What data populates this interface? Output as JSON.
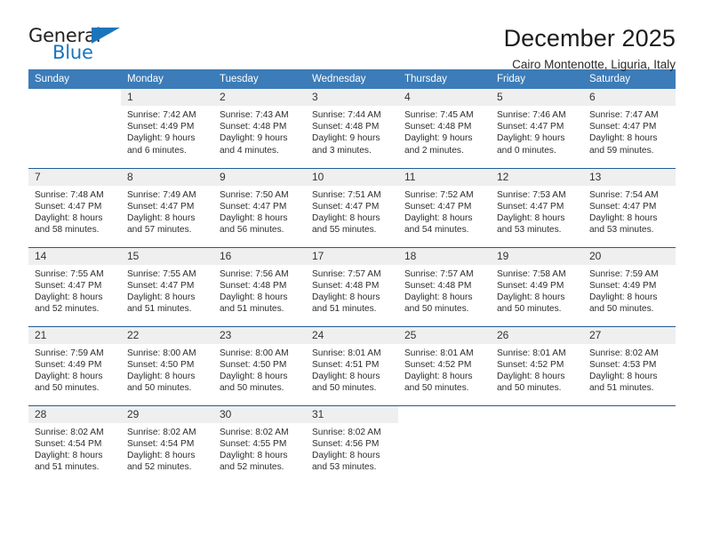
{
  "logo": {
    "word_one": "General",
    "word_two": "Blue",
    "triangle_icon": "triangle-icon",
    "brand_color": "#1b75bb"
  },
  "header": {
    "title": "December 2025",
    "subtitle": "Cairo Montenotte, Liguria, Italy"
  },
  "colors": {
    "header_bar": "#3c7cb8",
    "row_divider": "#1f5c99",
    "daynum_band": "#efefef"
  },
  "weekday_headers": [
    "Sunday",
    "Monday",
    "Tuesday",
    "Wednesday",
    "Thursday",
    "Friday",
    "Saturday"
  ],
  "weeks": [
    [
      {
        "day": "",
        "blank": true
      },
      {
        "day": "1",
        "sunrise": "Sunrise: 7:42 AM",
        "sunset": "Sunset: 4:49 PM",
        "daylight1": "Daylight: 9 hours",
        "daylight2": "and 6 minutes."
      },
      {
        "day": "2",
        "sunrise": "Sunrise: 7:43 AM",
        "sunset": "Sunset: 4:48 PM",
        "daylight1": "Daylight: 9 hours",
        "daylight2": "and 4 minutes."
      },
      {
        "day": "3",
        "sunrise": "Sunrise: 7:44 AM",
        "sunset": "Sunset: 4:48 PM",
        "daylight1": "Daylight: 9 hours",
        "daylight2": "and 3 minutes."
      },
      {
        "day": "4",
        "sunrise": "Sunrise: 7:45 AM",
        "sunset": "Sunset: 4:48 PM",
        "daylight1": "Daylight: 9 hours",
        "daylight2": "and 2 minutes."
      },
      {
        "day": "5",
        "sunrise": "Sunrise: 7:46 AM",
        "sunset": "Sunset: 4:47 PM",
        "daylight1": "Daylight: 9 hours",
        "daylight2": "and 0 minutes."
      },
      {
        "day": "6",
        "sunrise": "Sunrise: 7:47 AM",
        "sunset": "Sunset: 4:47 PM",
        "daylight1": "Daylight: 8 hours",
        "daylight2": "and 59 minutes."
      }
    ],
    [
      {
        "day": "7",
        "sunrise": "Sunrise: 7:48 AM",
        "sunset": "Sunset: 4:47 PM",
        "daylight1": "Daylight: 8 hours",
        "daylight2": "and 58 minutes."
      },
      {
        "day": "8",
        "sunrise": "Sunrise: 7:49 AM",
        "sunset": "Sunset: 4:47 PM",
        "daylight1": "Daylight: 8 hours",
        "daylight2": "and 57 minutes."
      },
      {
        "day": "9",
        "sunrise": "Sunrise: 7:50 AM",
        "sunset": "Sunset: 4:47 PM",
        "daylight1": "Daylight: 8 hours",
        "daylight2": "and 56 minutes."
      },
      {
        "day": "10",
        "sunrise": "Sunrise: 7:51 AM",
        "sunset": "Sunset: 4:47 PM",
        "daylight1": "Daylight: 8 hours",
        "daylight2": "and 55 minutes."
      },
      {
        "day": "11",
        "sunrise": "Sunrise: 7:52 AM",
        "sunset": "Sunset: 4:47 PM",
        "daylight1": "Daylight: 8 hours",
        "daylight2": "and 54 minutes."
      },
      {
        "day": "12",
        "sunrise": "Sunrise: 7:53 AM",
        "sunset": "Sunset: 4:47 PM",
        "daylight1": "Daylight: 8 hours",
        "daylight2": "and 53 minutes."
      },
      {
        "day": "13",
        "sunrise": "Sunrise: 7:54 AM",
        "sunset": "Sunset: 4:47 PM",
        "daylight1": "Daylight: 8 hours",
        "daylight2": "and 53 minutes."
      }
    ],
    [
      {
        "day": "14",
        "sunrise": "Sunrise: 7:55 AM",
        "sunset": "Sunset: 4:47 PM",
        "daylight1": "Daylight: 8 hours",
        "daylight2": "and 52 minutes."
      },
      {
        "day": "15",
        "sunrise": "Sunrise: 7:55 AM",
        "sunset": "Sunset: 4:47 PM",
        "daylight1": "Daylight: 8 hours",
        "daylight2": "and 51 minutes."
      },
      {
        "day": "16",
        "sunrise": "Sunrise: 7:56 AM",
        "sunset": "Sunset: 4:48 PM",
        "daylight1": "Daylight: 8 hours",
        "daylight2": "and 51 minutes."
      },
      {
        "day": "17",
        "sunrise": "Sunrise: 7:57 AM",
        "sunset": "Sunset: 4:48 PM",
        "daylight1": "Daylight: 8 hours",
        "daylight2": "and 51 minutes."
      },
      {
        "day": "18",
        "sunrise": "Sunrise: 7:57 AM",
        "sunset": "Sunset: 4:48 PM",
        "daylight1": "Daylight: 8 hours",
        "daylight2": "and 50 minutes."
      },
      {
        "day": "19",
        "sunrise": "Sunrise: 7:58 AM",
        "sunset": "Sunset: 4:49 PM",
        "daylight1": "Daylight: 8 hours",
        "daylight2": "and 50 minutes."
      },
      {
        "day": "20",
        "sunrise": "Sunrise: 7:59 AM",
        "sunset": "Sunset: 4:49 PM",
        "daylight1": "Daylight: 8 hours",
        "daylight2": "and 50 minutes."
      }
    ],
    [
      {
        "day": "21",
        "sunrise": "Sunrise: 7:59 AM",
        "sunset": "Sunset: 4:49 PM",
        "daylight1": "Daylight: 8 hours",
        "daylight2": "and 50 minutes."
      },
      {
        "day": "22",
        "sunrise": "Sunrise: 8:00 AM",
        "sunset": "Sunset: 4:50 PM",
        "daylight1": "Daylight: 8 hours",
        "daylight2": "and 50 minutes."
      },
      {
        "day": "23",
        "sunrise": "Sunrise: 8:00 AM",
        "sunset": "Sunset: 4:50 PM",
        "daylight1": "Daylight: 8 hours",
        "daylight2": "and 50 minutes."
      },
      {
        "day": "24",
        "sunrise": "Sunrise: 8:01 AM",
        "sunset": "Sunset: 4:51 PM",
        "daylight1": "Daylight: 8 hours",
        "daylight2": "and 50 minutes."
      },
      {
        "day": "25",
        "sunrise": "Sunrise: 8:01 AM",
        "sunset": "Sunset: 4:52 PM",
        "daylight1": "Daylight: 8 hours",
        "daylight2": "and 50 minutes."
      },
      {
        "day": "26",
        "sunrise": "Sunrise: 8:01 AM",
        "sunset": "Sunset: 4:52 PM",
        "daylight1": "Daylight: 8 hours",
        "daylight2": "and 50 minutes."
      },
      {
        "day": "27",
        "sunrise": "Sunrise: 8:02 AM",
        "sunset": "Sunset: 4:53 PM",
        "daylight1": "Daylight: 8 hours",
        "daylight2": "and 51 minutes."
      }
    ],
    [
      {
        "day": "28",
        "sunrise": "Sunrise: 8:02 AM",
        "sunset": "Sunset: 4:54 PM",
        "daylight1": "Daylight: 8 hours",
        "daylight2": "and 51 minutes."
      },
      {
        "day": "29",
        "sunrise": "Sunrise: 8:02 AM",
        "sunset": "Sunset: 4:54 PM",
        "daylight1": "Daylight: 8 hours",
        "daylight2": "and 52 minutes."
      },
      {
        "day": "30",
        "sunrise": "Sunrise: 8:02 AM",
        "sunset": "Sunset: 4:55 PM",
        "daylight1": "Daylight: 8 hours",
        "daylight2": "and 52 minutes."
      },
      {
        "day": "31",
        "sunrise": "Sunrise: 8:02 AM",
        "sunset": "Sunset: 4:56 PM",
        "daylight1": "Daylight: 8 hours",
        "daylight2": "and 53 minutes."
      },
      {
        "day": "",
        "blank": true
      },
      {
        "day": "",
        "blank": true
      },
      {
        "day": "",
        "blank": true
      }
    ]
  ]
}
